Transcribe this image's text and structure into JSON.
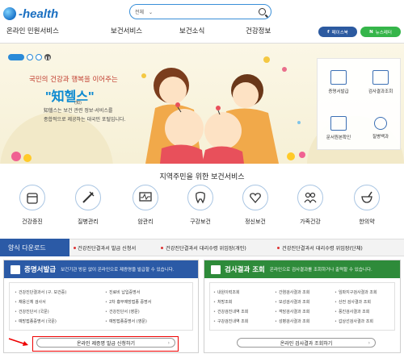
{
  "header": {
    "logo_text": "-health",
    "search": {
      "scope": "전체"
    }
  },
  "nav": {
    "items": [
      "온라인 민원서비스",
      "보건서비스",
      "보건소식",
      "건강정보"
    ],
    "facebook": "페이스북",
    "newsletter": "뉴스레터"
  },
  "banner": {
    "tagline": "국민의 건강과 행복을 이어주는",
    "brand": "\"知헬스\"",
    "hanja": "(知)",
    "desc_line1": "知헬스는 보건 관련 정보·서비스를",
    "desc_line2": "종합적으로 제공하는 대국민 포털입니다.",
    "quick_links": [
      {
        "label": "증명서발급",
        "icon": "printer-icon"
      },
      {
        "label": "검사결과조회",
        "icon": "monitor-icon"
      },
      {
        "label": "문서원본확인",
        "icon": "document-check-icon"
      },
      {
        "label": "질병백과",
        "icon": "stethoscope-icon"
      }
    ]
  },
  "services": {
    "title": "지역주민을 위한 보건서비스",
    "items": [
      {
        "label": "건강증진",
        "icon": "pills-icon"
      },
      {
        "label": "질병관리",
        "icon": "syringe-icon"
      },
      {
        "label": "암관리",
        "icon": "monitor-pulse-icon"
      },
      {
        "label": "구강보건",
        "icon": "tooth-icon"
      },
      {
        "label": "정신보건",
        "icon": "heart-pulse-icon"
      },
      {
        "label": "가족건강",
        "icon": "family-icon"
      },
      {
        "label": "한의약",
        "icon": "mortar-icon"
      }
    ]
  },
  "forms": {
    "tag": "양식 다운로드",
    "links": [
      "건강진단결과서 발급 신청서",
      "건강진단결과서 대리수령 위임장(개인)",
      "건강진단결과서 대리수령 위임장(단체)"
    ]
  },
  "certificates": {
    "title": "증명서발급",
    "subtitle": "보건기관 방문 없이 온라인으로 제증명을 발급할 수 있습니다.",
    "col1": [
      "건강진단결과서 (구. 보건증)",
      "채용신체 검사서",
      "건강진단서 (국문)",
      "예방접종증명서 (국문)"
    ],
    "col2": [
      "진료비 납입증명서",
      "2차 흉부예방접종 증명서",
      "건강진단서 (영문)",
      "예방접종증명서 (영문)"
    ],
    "cta": "온라인 제증명 발급 신청하기"
  },
  "results": {
    "title": "검사결과 조회",
    "subtitle": "온라인으로 검사결과를 조회하거나 출력할 수 있습니다.",
    "col1": [
      "내원이력조회",
      "처방조회",
      "건강검진내역 조회",
      "구강검진내역 조회"
    ],
    "col2": [
      "간염검사결과 조회",
      "모성검사결과 조회",
      "객담검사결과 조회",
      "성병검사결과 조회"
    ],
    "col3": [
      "임파지구검사결과 조회",
      "산전 검사결과 조회",
      "풍진검사결과 조회",
      "갑상선검사결과 조회"
    ],
    "cta": "온라인 검사결과 조회하기"
  },
  "colors": {
    "primary": "#2b5aa6",
    "accent_blue": "#1a6fc1",
    "results_green": "#2e8b3a",
    "highlight_red": "#e00000"
  }
}
